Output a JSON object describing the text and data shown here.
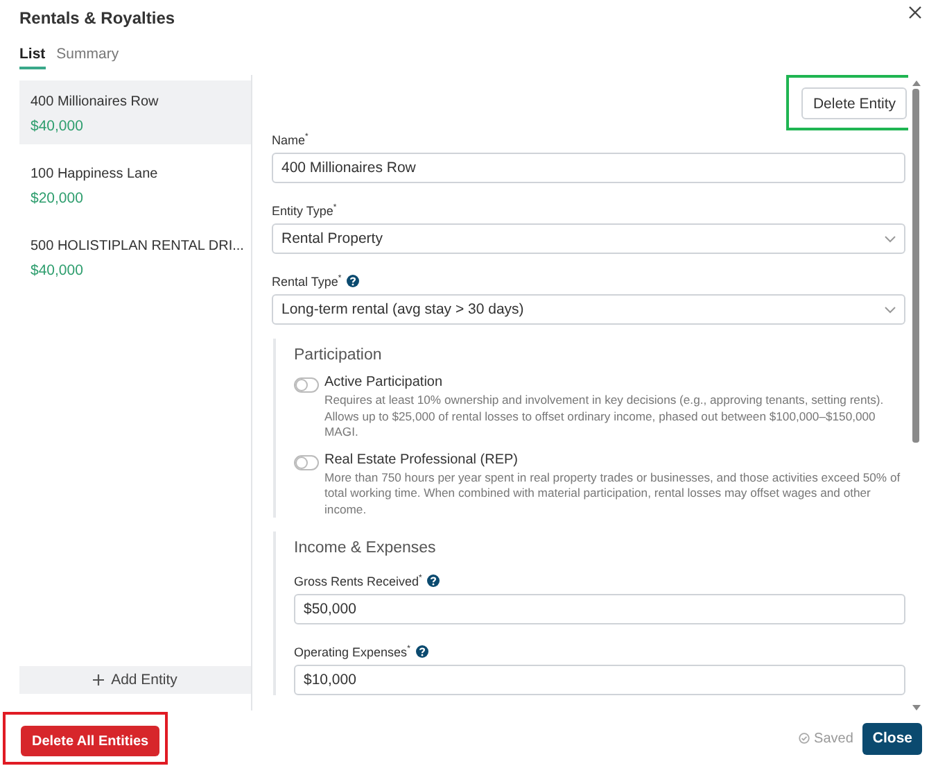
{
  "dialog": {
    "title": "Rentals & Royalties"
  },
  "tabs": [
    {
      "label": "List",
      "selected": true
    },
    {
      "label": "Summary",
      "selected": false
    }
  ],
  "entities": [
    {
      "name": "400 Millionaires Row",
      "amount": "$40,000",
      "selected": true
    },
    {
      "name": "100 Happiness Lane",
      "amount": "$20,000",
      "selected": false
    },
    {
      "name": "500 HOLISTIPLAN RENTAL DRI...",
      "amount": "$40,000",
      "selected": false
    }
  ],
  "add_entity_button": "Add Entity",
  "delete_entity_button": {
    "label": "Delete Entity",
    "highlighted": true
  },
  "fields": [
    {
      "kind": "text",
      "label": "Name$^{*}$",
      "help": false,
      "value": "400 Millionaires Row"
    },
    {
      "kind": "select",
      "label": "Entity Type$^{*}$",
      "help": false,
      "value": "Rental Property"
    },
    {
      "kind": "select",
      "label": "Rental Type$^{*}$",
      "help": true,
      "value": "Long-term rental (avg stay > 30 days)"
    }
  ],
  "sections": [
    {
      "title": "Participation",
      "items": [
        {
          "kind": "toggle",
          "label": "Active Participation",
          "on": false,
          "description": "Requires at least 10% ownership and involvement in key decisions (e.g., approving tenants, setting rents). Allows up to $25,000 of rental losses to offset ordinary income, phased out between $100,000–$150,000 MAGI."
        },
        {
          "kind": "toggle",
          "label": "Real Estate Professional (REP)",
          "on": false,
          "description": "More than 750 hours per year spent in real property trades or businesses, and those activities exceed 50% of total working time. When combined with material participation, rental losses may offset wages and other income."
        }
      ]
    },
    {
      "title": "Income & Expenses",
      "items": [
        {
          "kind": "text",
          "label": "Gross Rents Received$^{*}$",
          "help": true,
          "value": "$50,000"
        },
        {
          "kind": "text",
          "label": "Operating Expenses$^{*}$",
          "help": true,
          "value": "$10,000"
        }
      ]
    }
  ],
  "footer": {
    "delete_all_button": {
      "label": "Delete All Entities",
      "highlighted": true
    },
    "status": "Saved",
    "close_button": "Close"
  }
}
